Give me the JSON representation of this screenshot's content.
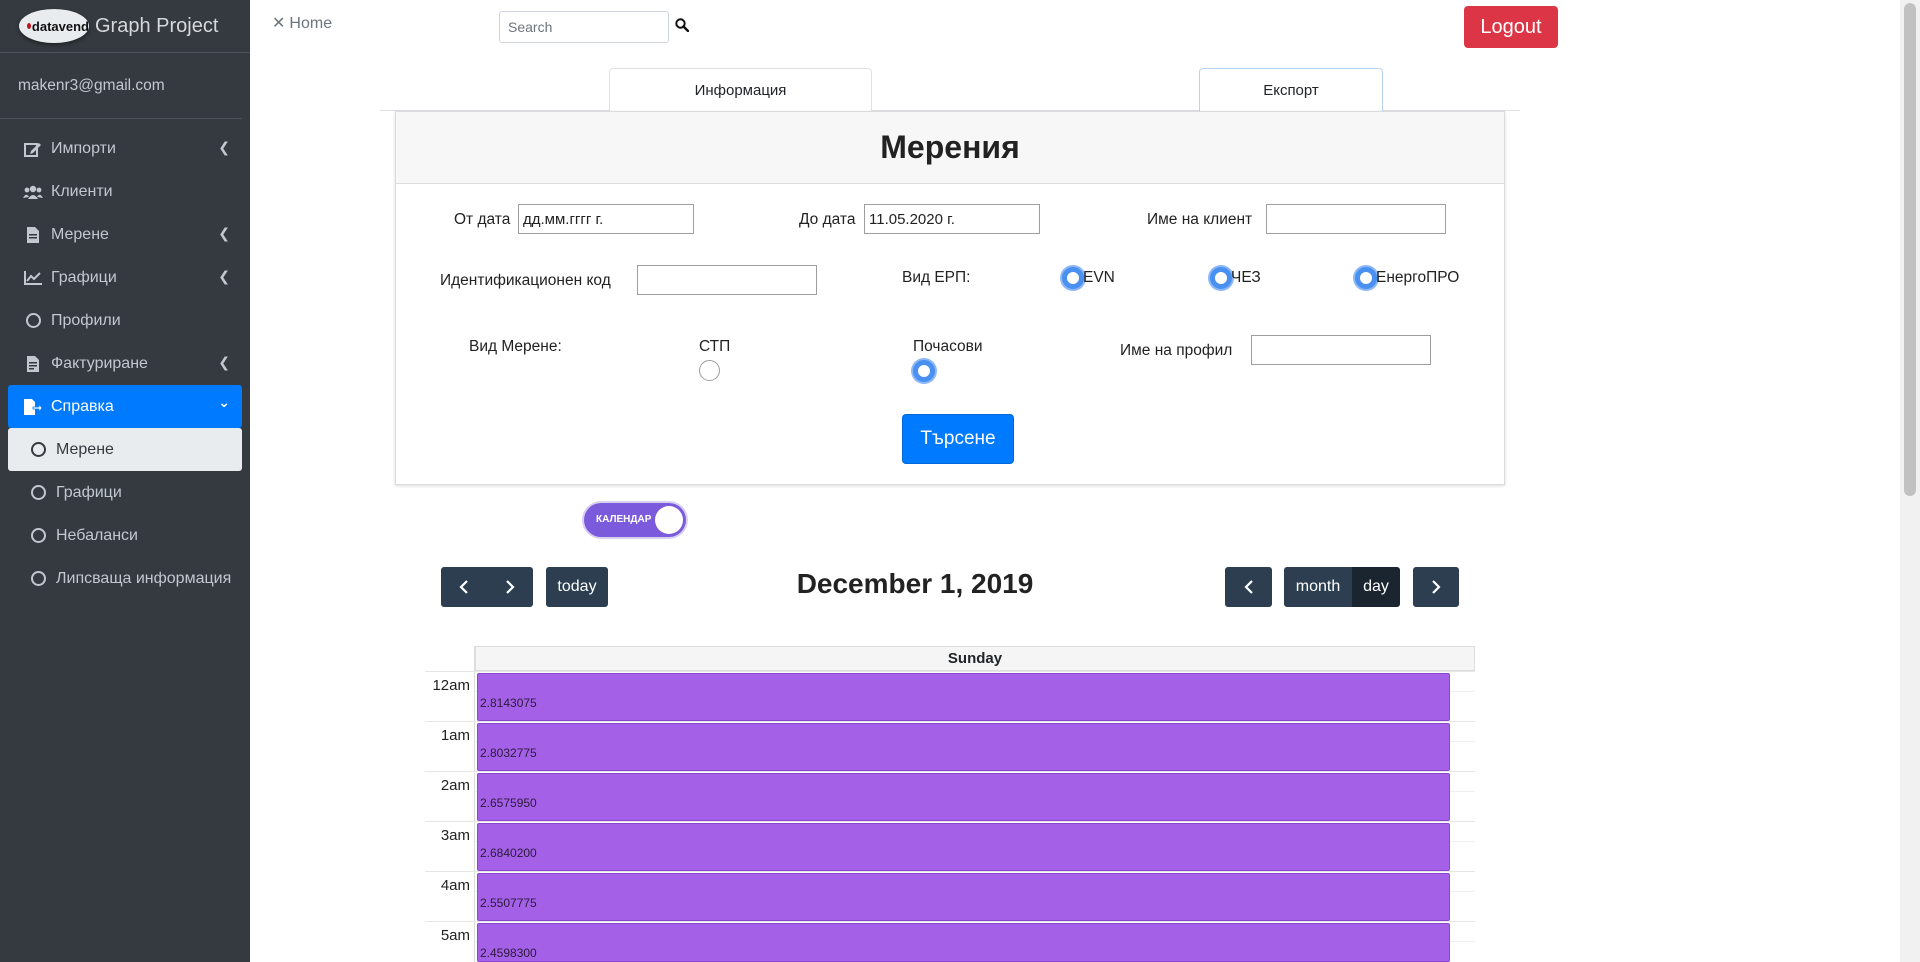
{
  "brand": {
    "logo_text": "datavend",
    "title": "Graph Project"
  },
  "user": {
    "email": "makenr3@gmail.com"
  },
  "sidebar": {
    "items": [
      {
        "label": "Импорти",
        "icon": "edit-icon",
        "chevron": "‹"
      },
      {
        "label": "Клиенти",
        "icon": "users-icon"
      },
      {
        "label": "Мерене",
        "icon": "file-icon",
        "chevron": "‹"
      },
      {
        "label": "Графици",
        "icon": "line-chart-icon",
        "chevron": "‹"
      },
      {
        "label": "Профили",
        "icon": "circle-icon"
      },
      {
        "label": "Фактуриране",
        "icon": "invoice-icon",
        "chevron": "‹"
      },
      {
        "label": "Справка",
        "icon": "report-icon",
        "chevron": "⌄"
      }
    ],
    "subitems": [
      {
        "label": "Мерене"
      },
      {
        "label": "Графици"
      },
      {
        "label": "Небаланси"
      },
      {
        "label": "Липсваща информация"
      }
    ]
  },
  "topbar": {
    "home_label": "Home",
    "search_placeholder": "Search",
    "logout_label": "Logout"
  },
  "tabs": {
    "info": "Информация",
    "export": "Експорт"
  },
  "form": {
    "title": "Мерения",
    "from_label": "От дата",
    "from_value": "дд.мм.гггг г.",
    "to_label": "До дата",
    "to_value": "11.05.2020 г.",
    "client_label": "Име на клиент",
    "client_value": "",
    "id_label": "Идентификационен код",
    "id_value": "",
    "erp_label": "Вид ЕРП:",
    "erp_options": [
      "EVN",
      "ЧЕЗ",
      "ЕнергоПРО"
    ],
    "measure_label": "Вид Мерене:",
    "measure_options": [
      "СТП",
      "Почасови"
    ],
    "measure_selected": "Почасови",
    "profile_label": "Име на профил",
    "profile_value": "",
    "search_button": "Търсене"
  },
  "toggle": {
    "label": "КАЛЕНДАР",
    "state": "on"
  },
  "calendar": {
    "title": "December 1, 2019",
    "today_label": "today",
    "month_label": "month",
    "day_label": "day",
    "day_header": "Sunday",
    "slots": [
      {
        "time": "12am",
        "value": "2.8143075"
      },
      {
        "time": "1am",
        "value": "2.8032775"
      },
      {
        "time": "2am",
        "value": "2.6575950"
      },
      {
        "time": "3am",
        "value": "2.6840200"
      },
      {
        "time": "4am",
        "value": "2.5507775"
      },
      {
        "time": "5am",
        "value": "2.4598300"
      }
    ]
  },
  "colors": {
    "sidebar_bg": "#343a40",
    "active": "#007bff",
    "logout": "#dc3545",
    "event": "#a461e8",
    "calendar_button": "#2c3e50",
    "toggle": "#7b5bdc"
  }
}
